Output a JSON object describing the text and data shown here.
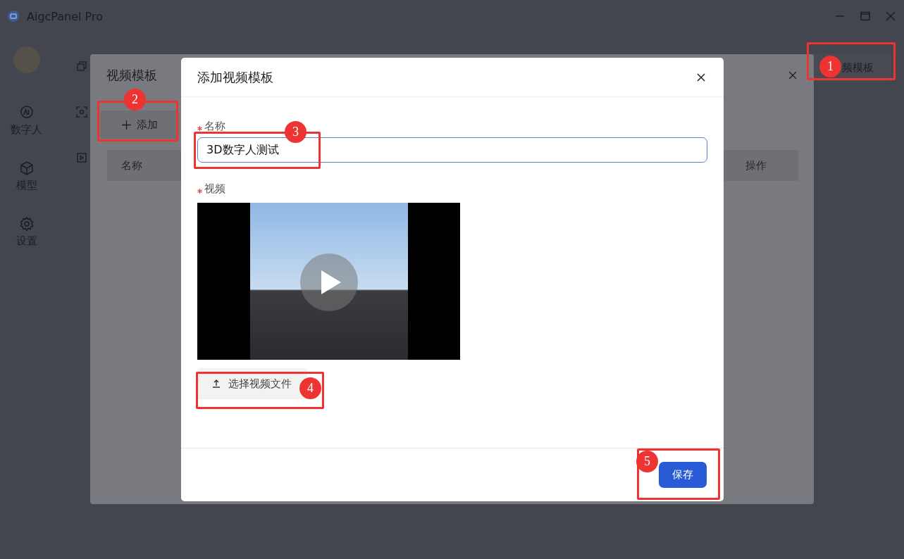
{
  "window": {
    "title": "AigcPanel Pro"
  },
  "sidebar": {
    "items": [
      {
        "label": "数字人"
      },
      {
        "label": "模型"
      },
      {
        "label": "设置"
      }
    ]
  },
  "header_button": {
    "label": "频模板"
  },
  "template_dialog": {
    "title": "视频模板",
    "add_button": "添加",
    "table": {
      "columns": [
        "名称",
        "操作"
      ]
    }
  },
  "add_dialog": {
    "title": "添加视频模板",
    "fields": [
      {
        "kind": "text",
        "label": "名称",
        "required": true,
        "value": "3D数字人测试"
      },
      {
        "kind": "video",
        "label": "视频",
        "required": true,
        "upload_button": "选择视频文件"
      }
    ],
    "save_button": "保存"
  },
  "annotations": [
    {
      "number": "1"
    },
    {
      "number": "2"
    },
    {
      "number": "3"
    },
    {
      "number": "4"
    },
    {
      "number": "5"
    }
  ]
}
